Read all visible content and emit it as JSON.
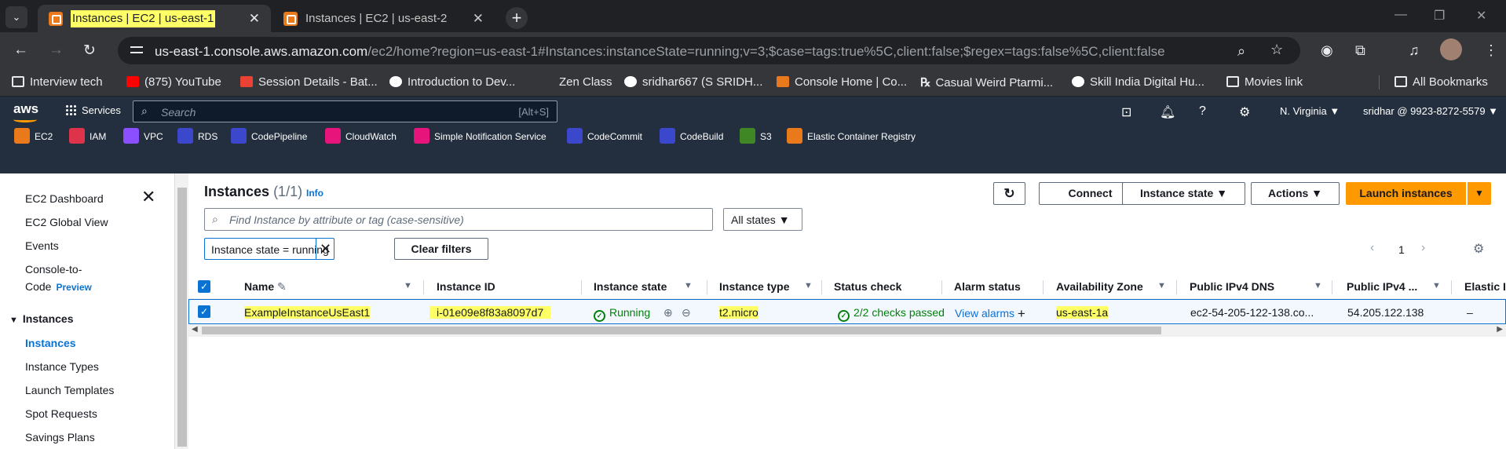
{
  "browser": {
    "tabs": [
      {
        "title": "Instances | EC2 | us-east-1",
        "active": true
      },
      {
        "title": "Instances | EC2 | us-east-2",
        "active": false
      }
    ],
    "url_host": "us-east-1.console.aws.amazon.com",
    "url_path": "/ec2/home?region=us-east-1#Instances:instanceState=running;v=3;$case=tags:true%5C,client:false;$regex=tags:false%5C,client:false",
    "bookmarks": [
      {
        "label": "Interview tech",
        "icon": "folder-icon",
        "color": "#e8eaed"
      },
      {
        "label": "(875) YouTube",
        "icon": "youtube-icon",
        "color": "#ff0000"
      },
      {
        "label": "Session Details - Bat...",
        "icon": "gmail-icon",
        "color": "#ea4335"
      },
      {
        "label": "Introduction to Dev...",
        "icon": "google-icon",
        "color": "#ffffff"
      },
      {
        "label": "Zen Class",
        "icon": "blank-icon",
        "color": "#35363a"
      },
      {
        "label": "sridhar667 (S SRIDH...",
        "icon": "github-icon",
        "color": "#ffffff"
      },
      {
        "label": "Console Home | Co...",
        "icon": "aws-cube-icon",
        "color": "#e9791a"
      },
      {
        "label": "Casual Weird Ptarmi...",
        "icon": "rx-icon",
        "color": "#e8eaed"
      },
      {
        "label": "Skill India Digital Hu...",
        "icon": "skill-india-icon",
        "color": "#ffffff"
      },
      {
        "label": "Movies link",
        "icon": "folder-icon",
        "color": "#e8eaed"
      }
    ],
    "all_bookmarks": "All Bookmarks"
  },
  "aws": {
    "logo": "aws",
    "services": "Services",
    "search_placeholder": "Search",
    "search_shortcut": "[Alt+S]",
    "region": "N. Virginia ▼",
    "account": "sridhar @ 9923-8272-5579 ▼",
    "favorites": [
      {
        "label": "EC2",
        "color": "#e9791a"
      },
      {
        "label": "IAM",
        "color": "#dd344c"
      },
      {
        "label": "VPC",
        "color": "#8c4fff"
      },
      {
        "label": "RDS",
        "color": "#3b48cc"
      },
      {
        "label": "CodePipeline",
        "color": "#3b48cc"
      },
      {
        "label": "CloudWatch",
        "color": "#e7157b"
      },
      {
        "label": "Simple Notification Service",
        "color": "#e7157b"
      },
      {
        "label": "CodeCommit",
        "color": "#3b48cc"
      },
      {
        "label": "CodeBuild",
        "color": "#3b48cc"
      },
      {
        "label": "S3",
        "color": "#3f8624"
      },
      {
        "label": "Elastic Container Registry",
        "color": "#e9791a"
      }
    ]
  },
  "sidebar": {
    "items": [
      "EC2 Dashboard",
      "EC2 Global View",
      "Events",
      "Console-to-",
      "Code"
    ],
    "preview": "Preview",
    "section": "Instances",
    "section_items": [
      "Instances",
      "Instance Types",
      "Launch Templates",
      "Spot Requests",
      "Savings Plans"
    ]
  },
  "main": {
    "title": "Instances",
    "count": "(1/1)",
    "info": "Info",
    "buttons": {
      "connect": "Connect",
      "instance_state": "Instance state ▼",
      "actions": "Actions ▼",
      "launch": "Launch instances",
      "launch_caret": "▼"
    },
    "find_placeholder": "Find Instance by attribute or tag (case-sensitive)",
    "states_select": "All states  ▼",
    "filter_token": "Instance state = running",
    "clear_filters": "Clear filters",
    "page": "1",
    "columns": [
      "Name",
      "Instance ID",
      "Instance state",
      "Instance type",
      "Status check",
      "Alarm status",
      "Availability Zone",
      "Public IPv4 DNS",
      "Public IPv4 ...",
      "Elastic I"
    ],
    "row": {
      "name": "ExampleInstanceUsEast1",
      "instance_id": "i-01e09e8f83a8097d7",
      "state": "Running",
      "type": "t2.micro",
      "status_check": "2/2 checks passed",
      "alarm": "View alarms",
      "az": "us-east-1a",
      "dns": "ec2-54-205-122-138.co...",
      "ipv4": "54.205.122.138",
      "elastic": "–"
    }
  }
}
